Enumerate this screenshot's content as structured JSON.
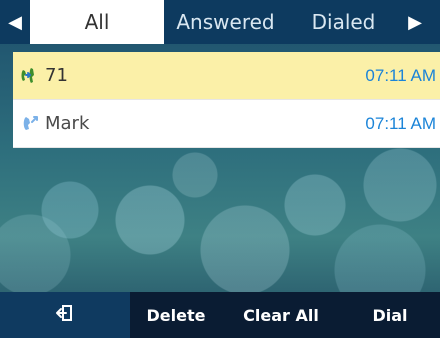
{
  "tabs": {
    "left_arrow": "◀",
    "right_arrow": "▶",
    "items": [
      {
        "label": "All"
      },
      {
        "label": "Answered"
      },
      {
        "label": "Dialed"
      }
    ]
  },
  "calls": [
    {
      "name": "71",
      "time": "07:11 AM",
      "icon": "incoming-call-icon"
    },
    {
      "name": "Mark",
      "time": "07:11 AM",
      "icon": "outgoing-call-icon"
    }
  ],
  "softkeys": {
    "back_icon": "back-icon",
    "delete": "Delete",
    "clear_all": "Clear All",
    "dial": "Dial"
  },
  "colors": {
    "tab_bar": "#0d3a5f",
    "selected_row": "#fbf0a8",
    "time_text": "#1b84d8",
    "softkey_bar": "#0a1c33",
    "incoming_icon_green": "#3e8e2d",
    "incoming_icon_blue": "#2a76c8",
    "outgoing_icon_blue": "#7bb1e8"
  }
}
